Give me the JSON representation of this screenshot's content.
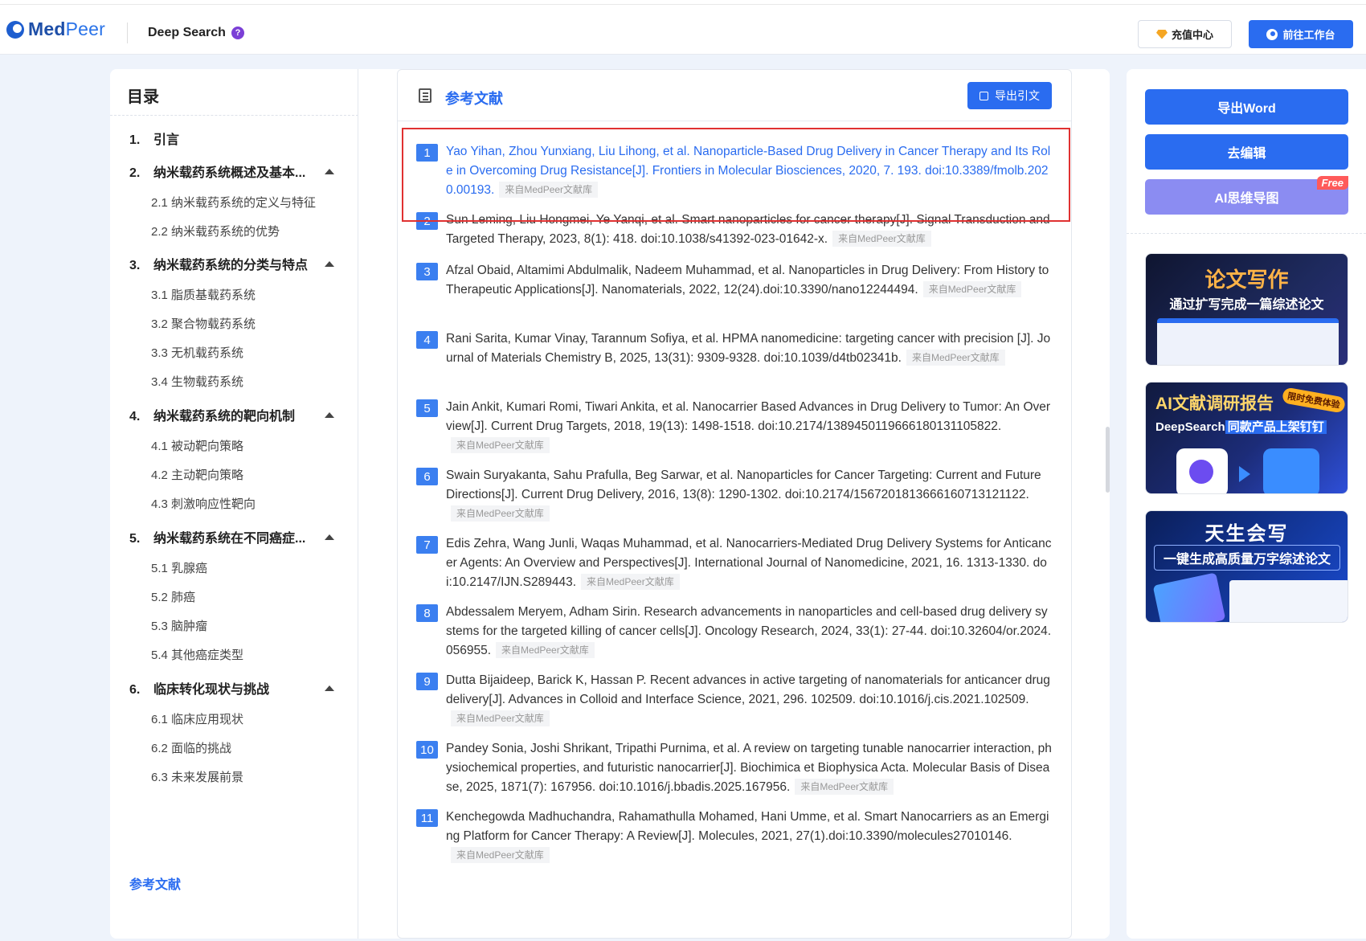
{
  "header": {
    "logo_main": "Med",
    "logo_accent": "Peer",
    "product": "Deep Search",
    "help": "?",
    "recharge_label": "充值中心",
    "workbench_label": "前往工作台"
  },
  "toc": {
    "title": "目录",
    "sections": [
      {
        "num": "1.",
        "label": "引言"
      },
      {
        "num": "2.",
        "label": "纳米载药系统概述及基本..."
      },
      {
        "num": "3.",
        "label": "纳米载药系统的分类与特点"
      },
      {
        "num": "4.",
        "label": "纳米载药系统的靶向机制"
      },
      {
        "num": "5.",
        "label": "纳米载药系统在不同癌症..."
      },
      {
        "num": "6.",
        "label": "临床转化现状与挑战"
      }
    ],
    "subs": [
      "2.1 纳米载药系统的定义与特征",
      "2.2 纳米载药系统的优势",
      "3.1 脂质基载药系统",
      "3.2 聚合物载药系统",
      "3.3 无机载药系统",
      "3.4 生物载药系统",
      "4.1 被动靶向策略",
      "4.2 主动靶向策略",
      "4.3 刺激响应性靶向",
      "5.1 乳腺癌",
      "5.2 肺癌",
      "5.3 脑肿瘤",
      "5.4 其他癌症类型",
      "6.1 临床应用现状",
      "6.2 面临的挑战",
      "6.3 未来发展前景"
    ],
    "references_label": "参考文献"
  },
  "references": {
    "title": "参考文献",
    "export_label": "导出引文",
    "source_tag": "来自MedPeer文献库",
    "items": [
      {
        "num": "1",
        "text": "Yao Yihan, Zhou Yunxiang, Liu Lihong, et al. Nanoparticle-Based Drug Delivery in Cancer Therapy and Its Role in Overcoming Drug Resistance[J]. Frontiers in Molecular Biosciences, 2020, 7. 193. doi:10.3389/fmolb.2020.00193."
      },
      {
        "num": "2",
        "text": "Sun Leming, Liu Hongmei, Ye Yanqi, et al. Smart nanoparticles for cancer therapy[J]. Signal Transduction and Targeted Therapy, 2023, 8(1): 418. doi:10.1038/s41392-023-01642-x."
      },
      {
        "num": "3",
        "text": "Afzal Obaid, Altamimi Abdulmalik, Nadeem Muhammad, et al. Nanoparticles in Drug Delivery: From History to Therapeutic Applications[J]. Nanomaterials, 2022, 12(24).doi:10.3390/nano12244494."
      },
      {
        "num": "4",
        "text": "Rani Sarita, Kumar Vinay, Tarannum Sofiya, et al. HPMA nanomedicine: targeting cancer with precision [J]. Journal of Materials Chemistry B, 2025, 13(31): 9309-9328. doi:10.1039/d4tb02341b."
      },
      {
        "num": "5",
        "text": "Jain Ankit, Kumari Romi, Tiwari Ankita, et al. Nanocarrier Based Advances in Drug Delivery to Tumor: An Overview[J]. Current Drug Targets, 2018, 19(13): 1498-1518. doi:10.2174/1389450119666180131105822."
      },
      {
        "num": "6",
        "text": "Swain Suryakanta, Sahu Prafulla, Beg Sarwar, et al. Nanoparticles for Cancer Targeting: Current and Future Directions[J]. Current Drug Delivery, 2016, 13(8): 1290-1302. doi:10.2174/1567201813666160713121122."
      },
      {
        "num": "7",
        "text": "Edis Zehra, Wang Junli, Waqas Muhammad, et al. Nanocarriers-Mediated Drug Delivery Systems for Anticancer Agents: An Overview and Perspectives[J]. International Journal of Nanomedicine, 2021, 16. 1313-1330. doi:10.2147/IJN.S289443."
      },
      {
        "num": "8",
        "text": "Abdessalem Meryem, Adham Sirin. Research advancements in nanoparticles and cell-based drug delivery systems for the targeted killing of cancer cells[J]. Oncology Research, 2024, 33(1): 27-44. doi:10.32604/or.2024.056955."
      },
      {
        "num": "9",
        "text": "Dutta Bijaideep, Barick K, Hassan P. Recent advances in active targeting of nanomaterials for anticancer drug delivery[J]. Advances in Colloid and Interface Science, 2021, 296. 102509. doi:10.1016/j.cis.2021.102509."
      },
      {
        "num": "10",
        "text": "Pandey Sonia, Joshi Shrikant, Tripathi Purnima, et al. A review on targeting tunable nanocarrier interaction, physiochemical properties, and futuristic nanocarrier[J]. Biochimica et Biophysica Acta. Molecular Basis of Disease, 2025, 1871(7): 167956. doi:10.1016/j.bbadis.2025.167956."
      },
      {
        "num": "11",
        "text": "Kenchegowda Madhuchandra, Rahamathulla Mohamed, Hani Umme, et al. Smart Nanocarriers as an Emerging Platform for Cancer Therapy: A Review[J]. Molecules, 2021, 27(1).doi:10.3390/molecules27010146."
      }
    ]
  },
  "sidebar": {
    "export_word": "导出Word",
    "edit": "去编辑",
    "mindmap": "AI思维导图",
    "free_badge": "Free",
    "banner1_title": "论文写作",
    "banner1_sub": "通过扩写完成一篇综述论文",
    "banner2_title": "AI文献调研报告",
    "banner2_badge": "限时免费体验",
    "banner2_sub_prefix": "DeepSearch",
    "banner2_sub_highlight": "同款产品上架钉钉",
    "banner3_title": "天生会写",
    "banner3_sub": "一键生成高质量万字综述论文"
  },
  "colors": {
    "accent": "#2a6cf0",
    "highlight_border": "#e03131",
    "badge": "#3b7ff0"
  }
}
